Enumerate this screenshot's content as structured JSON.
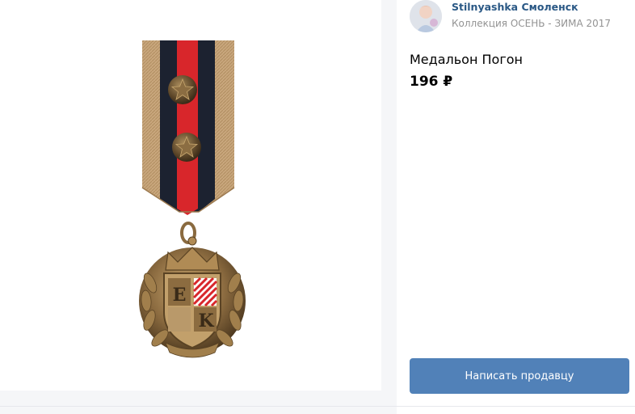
{
  "seller": {
    "name": "Stilnyashka Смоленск",
    "collection": "Коллекция ОСЕНЬ - ЗИМА 2017"
  },
  "product": {
    "title": "Медальон Погон",
    "price": "196 ₽",
    "image_monogram_top": "E",
    "image_monogram_bottom": "K"
  },
  "actions": {
    "contact_label": "Написать продавцу"
  },
  "colors": {
    "accent_button": "#5181b8",
    "link": "#2a5885",
    "muted_text": "#939393",
    "ribbon_red": "#d8262b",
    "ribbon_navy": "#1c2230",
    "ribbon_tan": "#c9a77d",
    "bronze": "#8a6a3f"
  },
  "icons": {
    "avatar": "seller-avatar",
    "badge_star": "star-icon"
  }
}
